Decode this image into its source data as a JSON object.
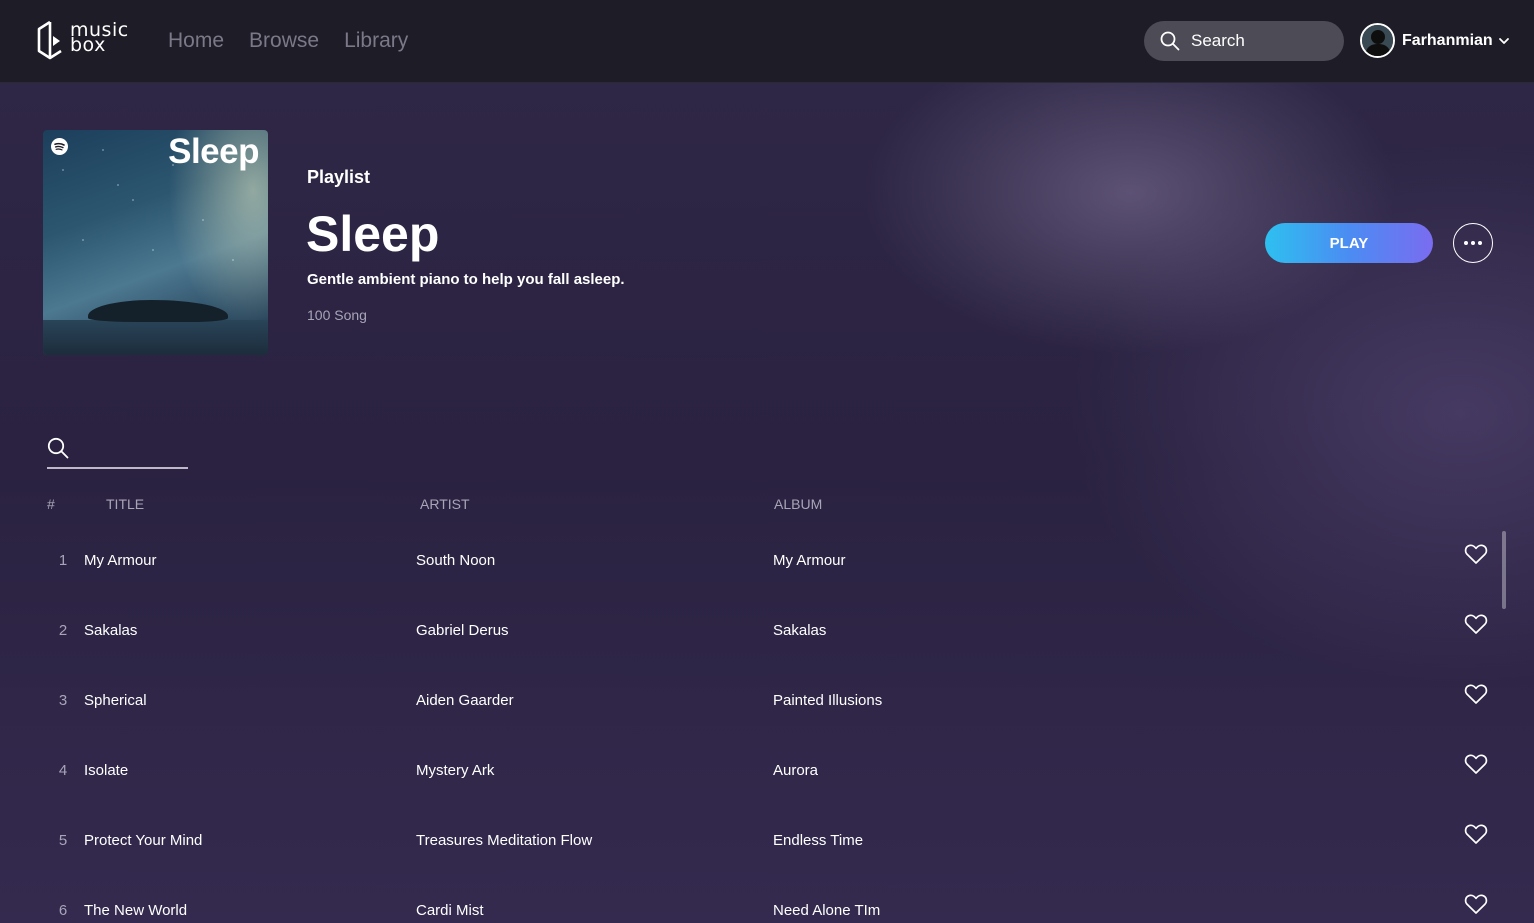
{
  "brand": {
    "line1": "music",
    "line2": "box"
  },
  "nav": [
    "Home",
    "Browse",
    "Library"
  ],
  "search": {
    "label": "Search"
  },
  "user": {
    "name": "Farhanmian"
  },
  "playlist": {
    "cover_title": "Sleep",
    "kind": "Playlist",
    "title": "Sleep",
    "description": "Gentle ambient piano to help you fall asleep.",
    "count": "100 Song",
    "play_label": "PLAY"
  },
  "track_search": {
    "placeholder": ""
  },
  "columns": {
    "num": "#",
    "title": "TITLE",
    "artist": "ARTIST",
    "album": "ALBUM"
  },
  "tracks": [
    {
      "num": "1",
      "title": "My Armour",
      "artist": "South  Noon",
      "album": "My Armour"
    },
    {
      "num": "2",
      "title": "Sakalas",
      "artist": "Gabriel  Derus",
      "album": "Sakalas"
    },
    {
      "num": "3",
      "title": "Spherical",
      "artist": "Aiden  Gaarder",
      "album": "Painted Illusions"
    },
    {
      "num": "4",
      "title": "Isolate",
      "artist": "Mystery  Ark",
      "album": "Aurora"
    },
    {
      "num": "5",
      "title": "Protect Your Mind",
      "artist": "Treasures  Meditation  Flow",
      "album": "Endless Time"
    },
    {
      "num": "6",
      "title": "The New World",
      "artist": "Cardi  Mist",
      "album": "Need Alone TIm"
    }
  ],
  "icons": {
    "logo": "musicbox-play-logo-icon",
    "search": "search-icon",
    "avatar": "avatar",
    "chevron": "chevron-down-icon",
    "more": "more-horizontal-icon",
    "heart": "heart-outline-icon"
  },
  "colors": {
    "topbar": "#1e1c26",
    "background": "#2c2440",
    "play_gradient_start": "#2ec0f0",
    "play_gradient_end": "#7a6cf0",
    "muted_text": "#a9a5b8"
  }
}
